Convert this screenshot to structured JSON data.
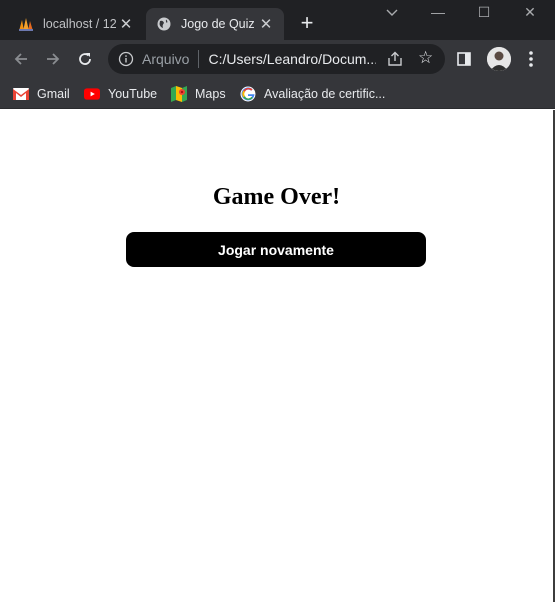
{
  "browser": {
    "tabs": [
      {
        "title": "localhost / 12",
        "icon": "phpmyadmin-icon",
        "active": false
      },
      {
        "title": "Jogo de Quiz",
        "icon": "globe-icon",
        "active": true
      }
    ],
    "new_tab_label": "+",
    "window_controls": {
      "minimize": "—",
      "maximize": "☐",
      "close": "✕"
    },
    "address": {
      "scheme": "Arquivo",
      "url": "C:/Users/Leandro/Docum..."
    },
    "bookmarks": [
      {
        "label": "Gmail",
        "icon": "gmail-icon"
      },
      {
        "label": "YouTube",
        "icon": "youtube-icon"
      },
      {
        "label": "Maps",
        "icon": "maps-icon"
      },
      {
        "label": "Avaliação de certific...",
        "icon": "google-icon"
      }
    ],
    "colors": {
      "frame": "#202124",
      "toolbar": "#35363a",
      "text": "#e8eaed"
    }
  },
  "page": {
    "heading": "Game Over!",
    "play_again_label": "Jogar novamente",
    "colors": {
      "button_bg": "#000000",
      "button_text": "#ffffff"
    }
  }
}
